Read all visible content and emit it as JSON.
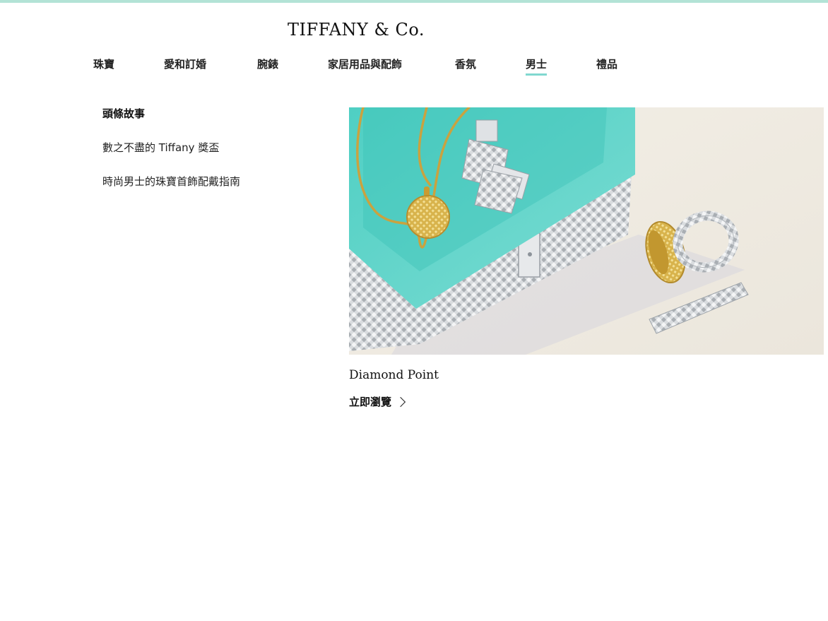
{
  "brand": {
    "logo_text": "TIFFANY & Co.",
    "accent_color": "#81d8d0",
    "top_bar_color": "#b3e3d6"
  },
  "nav": {
    "items": [
      {
        "label": "珠寶"
      },
      {
        "label": "愛和訂婚"
      },
      {
        "label": "腕錶"
      },
      {
        "label": "家居用品與配飾"
      },
      {
        "label": "香氛"
      },
      {
        "label": "男士",
        "active": true
      },
      {
        "label": "禮品"
      }
    ]
  },
  "side_menu": {
    "heading": "頭條故事",
    "items": [
      {
        "label": "數之不盡的 Tiffany 獎盃"
      },
      {
        "label": "時尚男士的珠寶首飾配戴指南"
      }
    ]
  },
  "feature": {
    "title": "Diamond Point",
    "cta_label": "立即瀏覽"
  }
}
